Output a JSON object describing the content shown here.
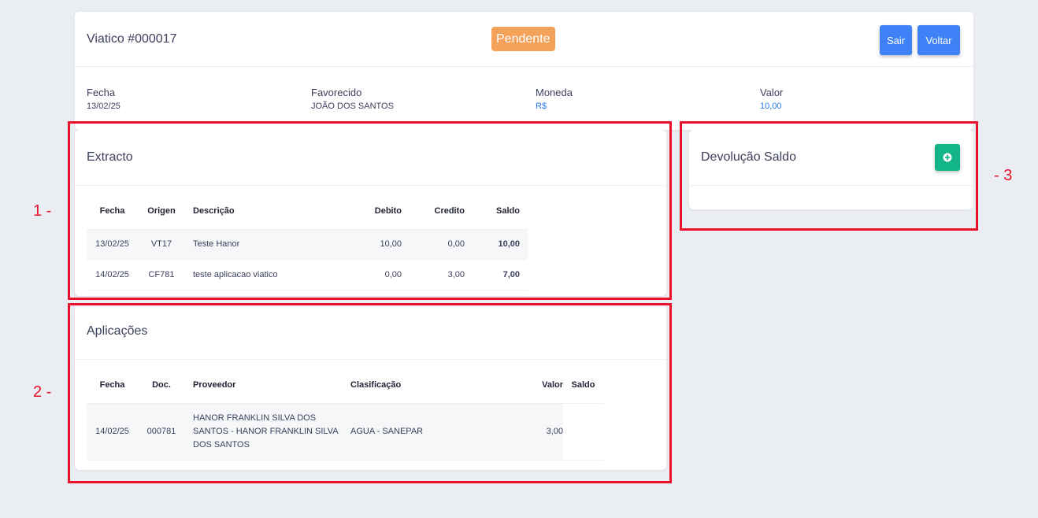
{
  "header": {
    "title": "Viatico #000017",
    "status": "Pendente",
    "exit_label": "Sair",
    "back_label": "Voltar"
  },
  "info": [
    {
      "label": "Fecha",
      "value": "13/02/25"
    },
    {
      "label": "Favorecido",
      "value": "JOÃO DOS SANTOS"
    },
    {
      "label": "Moneda",
      "value": "R$"
    },
    {
      "label": "Valor",
      "value": "10,00"
    }
  ],
  "extract": {
    "title": "Extracto",
    "columns": [
      "Fecha",
      "Origen",
      "Descrição",
      "Debito",
      "Credito",
      "Saldo"
    ],
    "rows": [
      {
        "fecha": "13/02/25",
        "origen": "VT17",
        "descricao": "Teste Hanor",
        "debito": "10,00",
        "credito": "0,00",
        "saldo": "10,00"
      },
      {
        "fecha": "14/02/25",
        "origen": "CF781",
        "descricao": "teste aplicacao viatico",
        "debito": "0,00",
        "credito": "3,00",
        "saldo": "7,00"
      }
    ]
  },
  "applications": {
    "title": "Aplicações",
    "columns": [
      "Fecha",
      "Doc.",
      "Proveedor",
      "Clasificação",
      "Valor",
      "Saldo"
    ],
    "rows": [
      {
        "fecha": "14/02/25",
        "doc": "000781",
        "proveedor": "HANOR FRANKLIN SILVA DOS SANTOS - HANOR FRANKLIN SILVA DOS SANTOS",
        "clasificacao": "AGUA - SANEPAR",
        "valor": "3,00",
        "saldo": ""
      }
    ]
  },
  "devolution": {
    "title": "Devolução Saldo",
    "add_icon": "plus-circle-icon"
  },
  "annotations": [
    "1 -",
    "2 -",
    "- 3"
  ],
  "colors": {
    "status_badge": "#f4a259",
    "primary_button": "#3f82f7",
    "add_button": "#12b48a",
    "highlight": "#e8122d",
    "link_value": "#2b7de9"
  }
}
